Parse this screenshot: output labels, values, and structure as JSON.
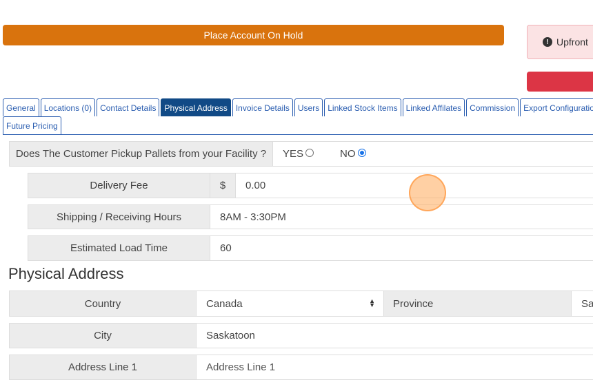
{
  "top": {
    "hold_button": "Place Account On Hold",
    "alert_text": "Upfront",
    "alert_icon": "!"
  },
  "tabs": {
    "row1": [
      "General",
      "Locations (0)",
      "Contact Details",
      "Physical Address",
      "Invoice Details",
      "Users",
      "Linked Stock Items",
      "Linked Affilates",
      "Commission",
      "Export Configuration"
    ],
    "row2": [
      "Future Pricing"
    ],
    "active": "Physical Address"
  },
  "pickup": {
    "question": "Does The Customer Pickup Pallets from your Facility ?",
    "yes_label": "YES",
    "no_label": "NO",
    "selected": "NO"
  },
  "delivery": {
    "fee_label": "Delivery Fee",
    "currency": "$",
    "fee_value": "0.00",
    "hours_label": "Shipping / Receiving Hours",
    "hours_value": "8AM - 3:30PM",
    "load_label": "Estimated Load Time",
    "load_value": "60"
  },
  "address": {
    "title": "Physical Address",
    "country_label": "Country",
    "country_value": "Canada",
    "province_label": "Province",
    "province_value": "Sa",
    "city_label": "City",
    "city_value": "Saskatoon",
    "line1_label": "Address Line 1",
    "line1_placeholder": "Address Line 1"
  },
  "colors": {
    "hold_button": "#d9730d",
    "active_tab": "#114a86",
    "danger": "#dc3545"
  }
}
